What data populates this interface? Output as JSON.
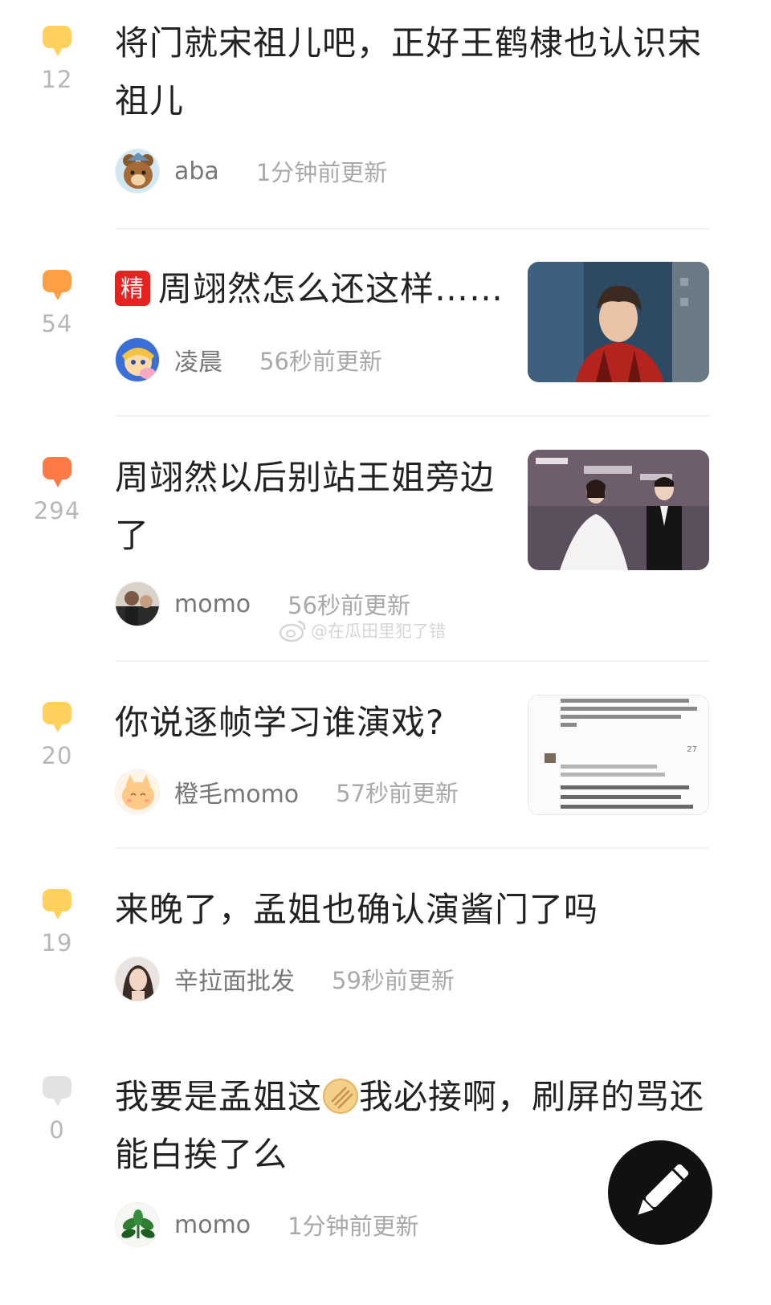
{
  "colors": {
    "bubble_yellow": "#ffd15c",
    "bubble_orange": "#ff9f45",
    "bubble_red_orange": "#ff7a45",
    "bubble_grey": "#e2e2e2",
    "jing_red": "#e8231f"
  },
  "posts": [
    {
      "count": "12",
      "bubble_color": "#ffd15c",
      "title": "将门就宋祖儿吧，正好王鹤棣也认识宋祖儿",
      "user": "aba",
      "time": "1分钟前更新",
      "avatar_icon": "bear-avatar"
    },
    {
      "count": "54",
      "bubble_color": "#ff9f45",
      "badge": "精",
      "title": "周翊然怎么还这样……",
      "user": "凌晨",
      "time": "56秒前更新",
      "avatar_icon": "anime-avatar",
      "thumb_icon": "man-red-shirt-photo"
    },
    {
      "count": "294",
      "bubble_color": "#ff7a45",
      "title": "周翊然以后别站王姐旁边了",
      "user": "momo",
      "time": "56秒前更新",
      "avatar_icon": "photo-avatar",
      "thumb_icon": "red-carpet-photo"
    },
    {
      "count": "20",
      "bubble_color": "#ffd15c",
      "title": "你说逐帧学习谁演戏?",
      "user": "橙毛momo",
      "time": "57秒前更新",
      "avatar_icon": "cat-avatar",
      "thumb_icon": "comment-screenshot-thumb",
      "thumb_badge": "27"
    },
    {
      "count": "19",
      "bubble_color": "#ffd15c",
      "title": "来晚了，孟姐也确认演酱门了吗",
      "user": "辛拉面批发",
      "time": "59秒前更新",
      "avatar_icon": "woman-avatar"
    },
    {
      "count": "0",
      "bubble_color": "#e2e2e2",
      "title_part1": "我要是孟姐这",
      "title_part2": "我必接啊，刷屏的骂还能白挨了么",
      "user": "momo",
      "time": "1分钟前更新",
      "avatar_icon": "plant-avatar",
      "emoji_icon": "cookie-emoji"
    }
  ],
  "watermark": "@在瓜田里犯了错",
  "fab_icon": "pencil-icon"
}
